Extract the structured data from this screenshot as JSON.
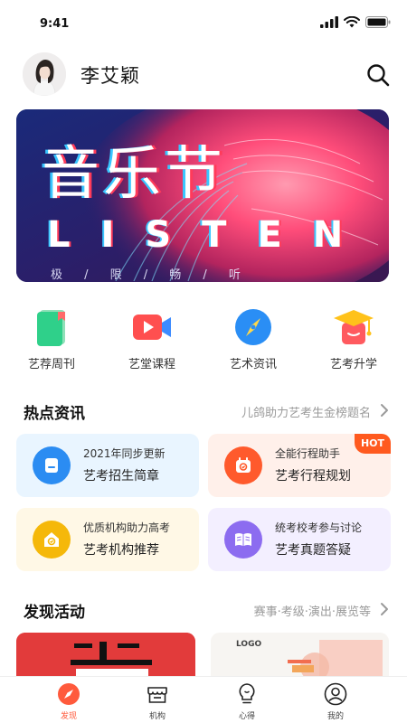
{
  "status_bar": {
    "time": "9:41"
  },
  "header": {
    "user_name": "李艾颖"
  },
  "banner": {
    "title": "音乐节",
    "title_en": "LISTEN",
    "subtitle": "极 / 限 / 畅 / 听"
  },
  "quick_links": [
    {
      "label": "艺荐周刊",
      "icon": "book-icon"
    },
    {
      "label": "艺堂课程",
      "icon": "video-icon"
    },
    {
      "label": "艺术资讯",
      "icon": "compass-icon"
    },
    {
      "label": "艺考升学",
      "icon": "graduation-cap-icon"
    }
  ],
  "hot_news": {
    "title": "热点资讯",
    "more": "儿鸽助力艺考生金榜题名",
    "cards": [
      {
        "line1": "2021年同步更新",
        "line2": "艺考招生简章",
        "icon": "document-icon",
        "bg": "#e9f5ff",
        "icon_bg": "#2b8cf2"
      },
      {
        "line1": "全能行程助手",
        "line2": "艺考行程规划",
        "icon": "calendar-icon",
        "bg": "#fff0ea",
        "icon_bg": "#ff5a2c",
        "badge": "HOT"
      },
      {
        "line1": "优质机构助力高考",
        "line2": "艺考机构推荐",
        "icon": "house-icon",
        "bg": "#fff8e6",
        "icon_bg": "#f5b80a"
      },
      {
        "line1": "统考校考参与讨论",
        "line2": "艺考真题答疑",
        "icon": "open-book-icon",
        "bg": "#f3efff",
        "icon_bg": "#8c6cf0"
      }
    ]
  },
  "discover": {
    "title": "发现活动",
    "more": "赛事·考级·演出·展览等",
    "thumb2_logo": "LOGO"
  },
  "tabbar": [
    {
      "label": "发现",
      "active": true
    },
    {
      "label": "机构",
      "active": false
    },
    {
      "label": "心得",
      "active": false
    },
    {
      "label": "我的",
      "active": false
    }
  ],
  "colors": {
    "accent": "#ff5a3c",
    "banner_bg": "#1c2360"
  }
}
